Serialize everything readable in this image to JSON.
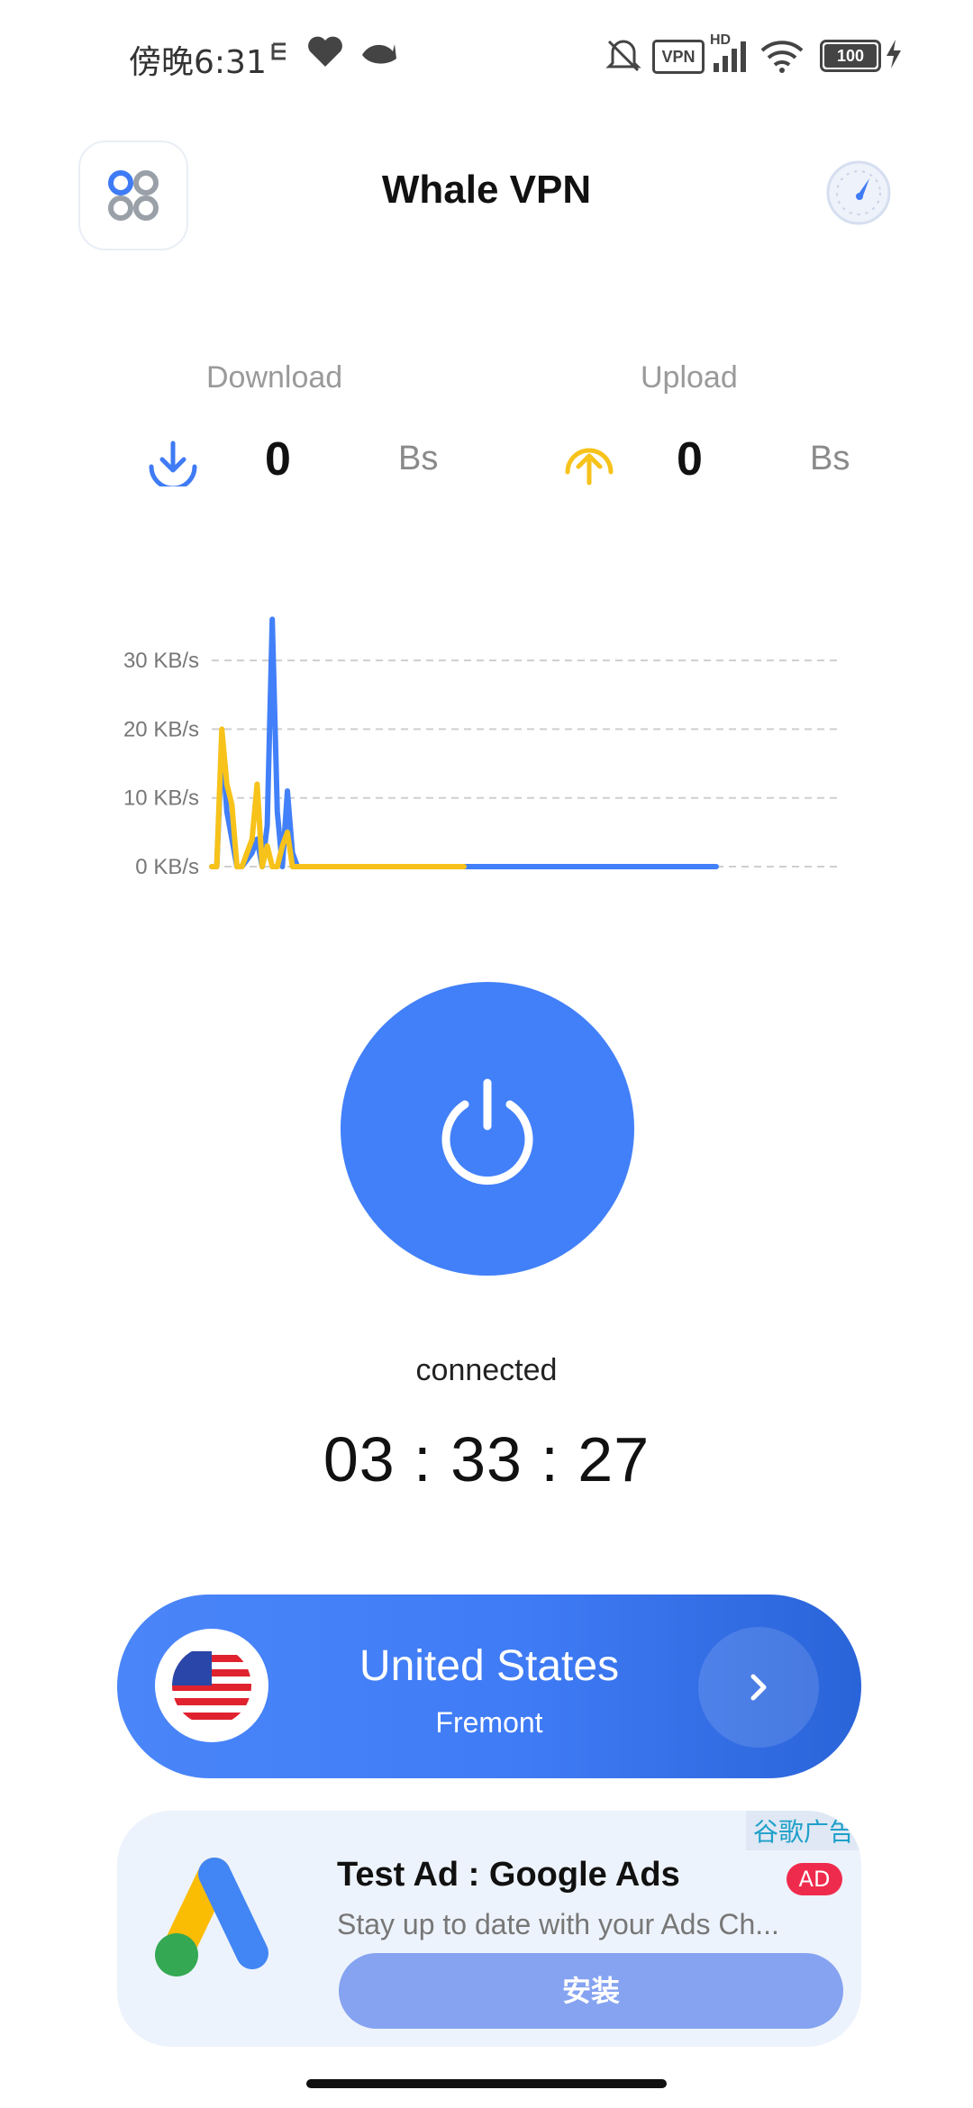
{
  "status_bar": {
    "time": "傍晚6:31",
    "vpn_badge": "VPN",
    "hd_label": "HD",
    "battery": "100",
    "icons": [
      "notification-icon",
      "heart-icon",
      "whale-icon",
      "mute-icon",
      "vpn-icon",
      "signal-icon",
      "wifi-icon",
      "battery-icon",
      "charging-icon"
    ]
  },
  "header": {
    "title": "Whale VPN",
    "menu_icon": "grid-icon",
    "speed_icon": "speedometer-icon"
  },
  "stats": {
    "download": {
      "label": "Download",
      "value": "0",
      "unit": "Bs",
      "icon": "download-arrow-icon",
      "color": "#3f7bf5"
    },
    "upload": {
      "label": "Upload",
      "value": "0",
      "unit": "Bs",
      "icon": "upload-arrow-icon",
      "color": "#f7c21a"
    }
  },
  "chart_data": {
    "type": "line",
    "y_ticks": [
      "0 KB/s",
      "10 KB/s",
      "20 KB/s",
      "30 KB/s"
    ],
    "ylim": [
      0,
      35
    ],
    "grid": true,
    "series": [
      {
        "color": "#4280f9",
        "x": [
          0,
          2,
          4,
          6,
          8,
          10,
          12,
          14,
          16,
          18,
          20,
          22,
          24,
          26,
          28,
          30,
          32,
          34,
          36,
          38,
          40,
          60,
          100,
          200
        ],
        "values": [
          0,
          0,
          18,
          8,
          4,
          0,
          0,
          1,
          2,
          4,
          0,
          6,
          36,
          8,
          0,
          11,
          2,
          0,
          0,
          0,
          0,
          0,
          0,
          0
        ]
      },
      {
        "color": "#f7c21a",
        "x": [
          0,
          2,
          4,
          6,
          8,
          10,
          12,
          14,
          16,
          18,
          20,
          22,
          24,
          26,
          28,
          30,
          32,
          34,
          36,
          38,
          40,
          60,
          100
        ],
        "values": [
          0,
          0,
          20,
          12,
          9,
          0,
          0,
          2,
          4,
          12,
          0,
          3,
          0,
          0,
          3,
          5,
          0,
          0,
          0,
          0,
          0,
          0,
          0
        ]
      }
    ]
  },
  "connection": {
    "power_icon": "power-icon",
    "status": "connected",
    "timer": "03 : 33 : 27"
  },
  "server": {
    "country": "United States",
    "city": "Fremont",
    "flag_icon": "us-flag-icon",
    "arrow_icon": "chevron-right-icon"
  },
  "ad": {
    "source_label": "谷歌广告",
    "title": "Test Ad : Google Ads",
    "badge": "AD",
    "body": "Stay up to date with your Ads Ch...",
    "install_label": "安装",
    "logo_icon": "google-ads-logo-icon"
  }
}
